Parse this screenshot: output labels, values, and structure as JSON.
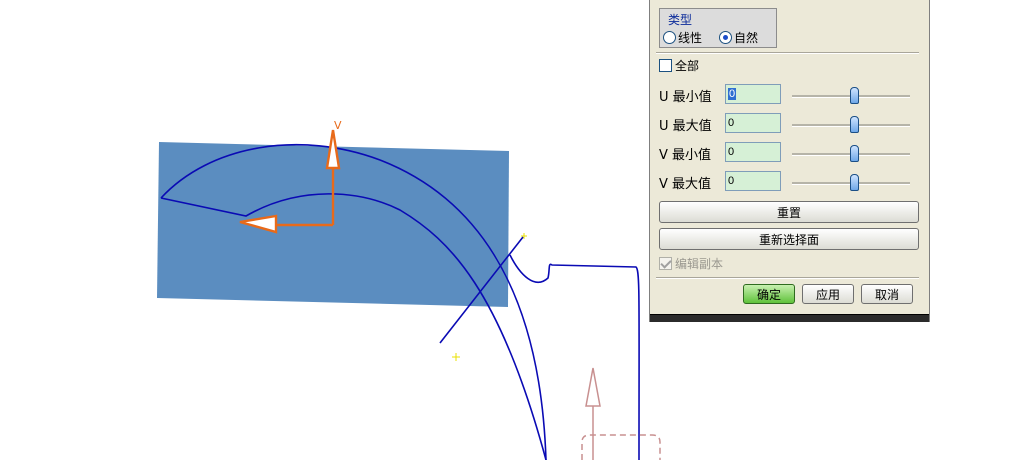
{
  "viewport": {
    "axis_v_label": "V",
    "surface_color": "#5b8dc0",
    "curve_color": "#0a0ab4",
    "axis_color": "#e86a1a"
  },
  "dialog": {
    "type_group": {
      "title": "类型",
      "options": [
        {
          "label": "线性",
          "checked": false
        },
        {
          "label": "自然",
          "checked": true
        }
      ]
    },
    "all_checkbox": {
      "label": "全部",
      "checked": false
    },
    "params": [
      {
        "label": "U 最小值",
        "value": "0",
        "slider_fraction": 0.5
      },
      {
        "label": "U 最大值",
        "value": "0",
        "slider_fraction": 0.5
      },
      {
        "label": "V 最小值",
        "value": "0",
        "slider_fraction": 0.5
      },
      {
        "label": "V 最大值",
        "value": "0",
        "slider_fraction": 0.5
      }
    ],
    "reset_label": "重置",
    "reselect_face_label": "重新选择面",
    "edit_copy": {
      "label": "编辑副本",
      "checked": true,
      "disabled": true
    },
    "ok_label": "确定",
    "apply_label": "应用",
    "cancel_label": "取消"
  }
}
